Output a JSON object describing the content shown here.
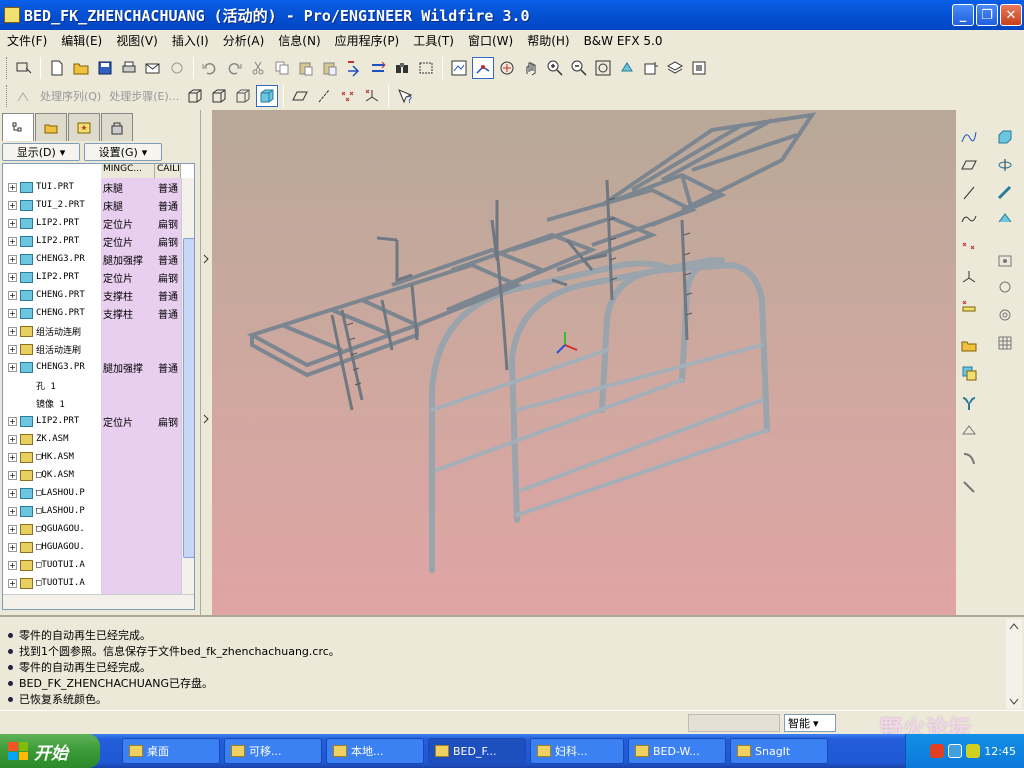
{
  "window": {
    "title": "BED_FK_ZHENCHACHUANG (活动的) - Pro/ENGINEER Wildfire 3.0"
  },
  "menubar": {
    "items": [
      "文件(F)",
      "编辑(E)",
      "视图(V)",
      "插入(I)",
      "分析(A)",
      "信息(N)",
      "应用程序(P)",
      "工具(T)",
      "窗口(W)",
      "帮助(H)",
      "B&W EFX 5.0"
    ]
  },
  "toolbar2": {
    "process_sequence": "处理序列(Q)",
    "process_step": "处理步骤(E)..."
  },
  "navigator": {
    "show_button": "显示(D)",
    "settings_button": "设置(G)",
    "columns": [
      "MINGC...",
      "CAILIA"
    ],
    "rows": [
      {
        "name": "TUI.PRT",
        "col1": "床腿",
        "col2": "普通",
        "type": "part"
      },
      {
        "name": "TUI_2.PRT",
        "col1": "床腿",
        "col2": "普通",
        "type": "part"
      },
      {
        "name": "LIP2.PRT",
        "col1": "定位片",
        "col2": "扁钢",
        "type": "part"
      },
      {
        "name": "LIP2.PRT",
        "col1": "定位片",
        "col2": "扁钢",
        "type": "part"
      },
      {
        "name": "CHENG3.PR",
        "col1": "腿加强撑",
        "col2": "普通",
        "type": "part"
      },
      {
        "name": "LIP2.PRT",
        "col1": "定位片",
        "col2": "扁钢",
        "type": "part"
      },
      {
        "name": "CHENG.PRT",
        "col1": "支撑柱",
        "col2": "普通",
        "type": "part"
      },
      {
        "name": "CHENG.PRT",
        "col1": "支撑柱",
        "col2": "普通",
        "type": "part"
      },
      {
        "name": "组活动连刷",
        "col1": "",
        "col2": "",
        "type": "group"
      },
      {
        "name": "组活动连刷",
        "col1": "",
        "col2": "",
        "type": "group"
      },
      {
        "name": "CHENG3.PR",
        "col1": "腿加强撑",
        "col2": "普通",
        "type": "part"
      },
      {
        "name": "孔 1",
        "col1": "",
        "col2": "",
        "type": "feature"
      },
      {
        "name": "镜像 1",
        "col1": "",
        "col2": "",
        "type": "feature"
      },
      {
        "name": "LIP2.PRT",
        "col1": "定位片",
        "col2": "扁钢",
        "type": "part"
      },
      {
        "name": "ZK.ASM",
        "col1": "",
        "col2": "",
        "type": "asm"
      },
      {
        "name": "□HK.ASM",
        "col1": "",
        "col2": "",
        "type": "asm"
      },
      {
        "name": "□QK.ASM",
        "col1": "",
        "col2": "",
        "type": "asm"
      },
      {
        "name": "□LASHOU.P",
        "col1": "",
        "col2": "",
        "type": "part"
      },
      {
        "name": "□LASHOU.P",
        "col1": "",
        "col2": "",
        "type": "part"
      },
      {
        "name": "□QGUAGOU.",
        "col1": "",
        "col2": "",
        "type": "asm"
      },
      {
        "name": "□HGUAGOU.",
        "col1": "",
        "col2": "",
        "type": "asm"
      },
      {
        "name": "□TUOTUI.A",
        "col1": "",
        "col2": "",
        "type": "asm"
      },
      {
        "name": "□TUOTUI.A",
        "col1": "",
        "col2": "",
        "type": "asm"
      }
    ]
  },
  "messages": [
    "零件的自动再生已经完成。",
    "找到1个圆参照。信息保存于文件bed_fk_zhenchachuang.crc。",
    "零件的自动再生已经完成。",
    "BED_FK_ZHENCHACHUANG已存盘。",
    "已恢复系统颜色。"
  ],
  "status": {
    "filter": "智能",
    "watermark": "野火论坛"
  },
  "taskbar": {
    "start": "开始",
    "tasks": [
      "桌面",
      "可移...",
      "本地...",
      "BED_F...",
      "妇科...",
      "BED-W...",
      "SnagIt"
    ],
    "clock": "12:45"
  },
  "colors": {
    "titlebar": "#0553d6",
    "viewport_top": "#b8a898",
    "viewport_bottom": "#e0a4a4",
    "navigator_columns": "#e8cff0",
    "taskbar": "#245edb"
  }
}
